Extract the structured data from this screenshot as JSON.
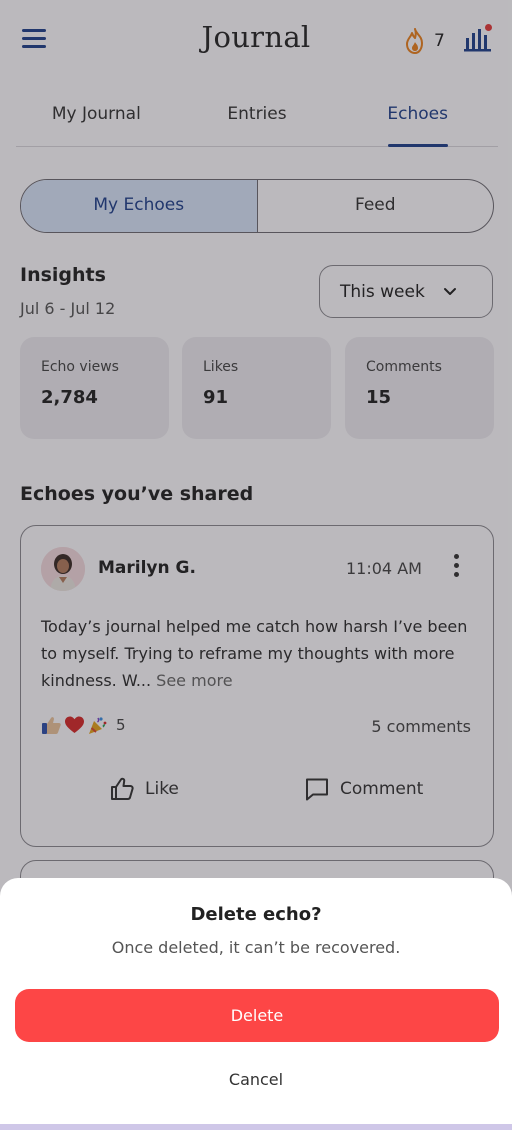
{
  "header": {
    "title": "Journal",
    "streak_count": "7",
    "icons": {
      "menu": "hamburger-menu-icon",
      "streak": "flame-icon",
      "stats": "bar-chart-icon"
    }
  },
  "tabs": [
    {
      "label": "My Journal",
      "active": false
    },
    {
      "label": "Entries",
      "active": false
    },
    {
      "label": "Echoes",
      "active": true
    }
  ],
  "segmented": [
    {
      "label": "My Echoes",
      "active": true
    },
    {
      "label": "Feed",
      "active": false
    }
  ],
  "insights": {
    "title": "Insights",
    "range": "Jul 6 - Jul 12",
    "period": "This week",
    "stats": [
      {
        "label": "Echo views",
        "value": "2,784"
      },
      {
        "label": "Likes",
        "value": "91"
      },
      {
        "label": "Comments",
        "value": "15"
      }
    ]
  },
  "shared": {
    "title": "Echoes you’ve shared",
    "echo": {
      "author": "Marilyn G.",
      "time": "11:04 AM",
      "text": "Today’s journal helped me catch how harsh I’ve been to myself.  Trying to reframe my thoughts with more kindness.  W...",
      "see_more": "See more",
      "reaction_icons": [
        "thumbs-up-icon",
        "heart-icon",
        "party-popper-icon"
      ],
      "reaction_count": "5",
      "comments_label": "5 comments",
      "like_label": "Like",
      "comment_label": "Comment"
    }
  },
  "dialog": {
    "title": "Delete echo?",
    "message": "Once deleted, it can’t be recovered.",
    "delete_label": "Delete",
    "cancel_label": "Cancel"
  },
  "colors": {
    "accent": "#1f3f8a",
    "danger": "#fd4646",
    "segment_active": "#d6e2f6",
    "streak_flame": "#e8801d"
  }
}
